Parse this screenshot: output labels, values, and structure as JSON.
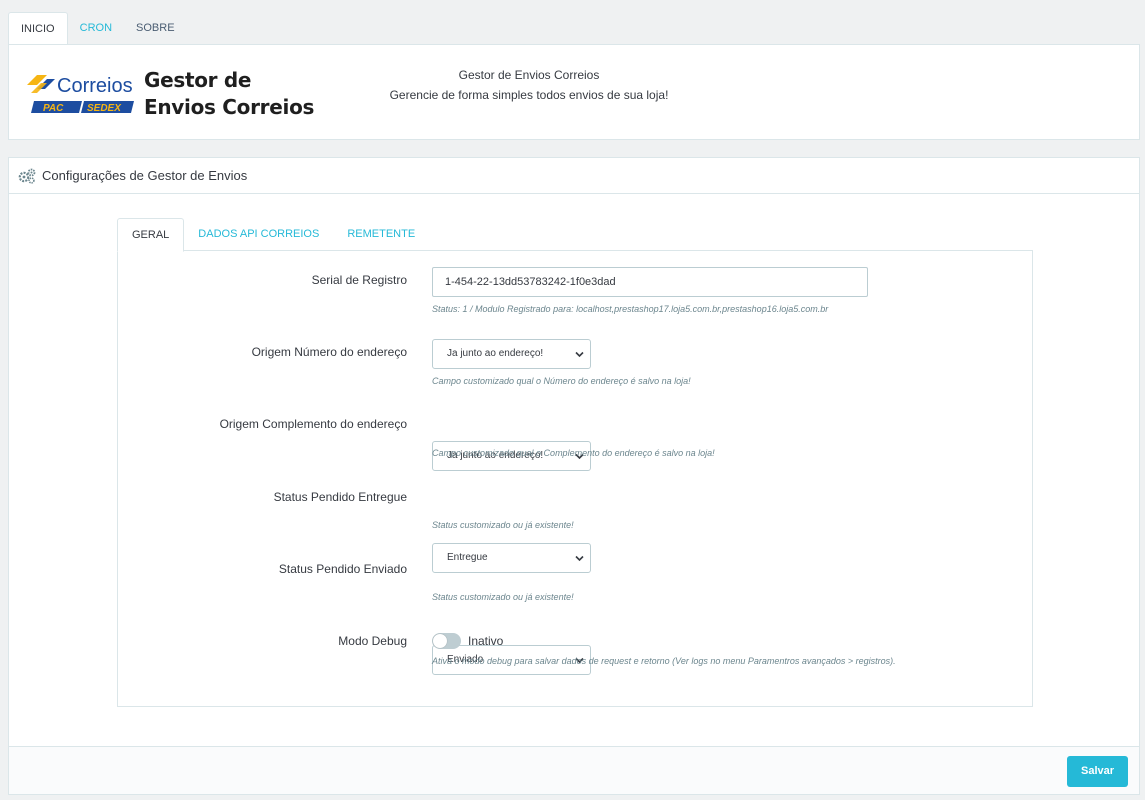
{
  "top_tabs": [
    {
      "label": "INICIO",
      "active": true
    },
    {
      "label": "CRON",
      "active": false
    },
    {
      "label": "SOBRE",
      "active": false
    }
  ],
  "header": {
    "logo_text": "Correios",
    "logo_badge_pac": "PAC",
    "logo_badge_sedex": "SEDEX",
    "title_line1": "Gestor de",
    "title_line2": "Envios Correios",
    "desc_line1": "Gestor de Envios Correios",
    "desc_line2": "Gerencie de forma simples todos envios de sua loja!"
  },
  "config": {
    "title": "Configurações de Gestor de Envios",
    "tabs": [
      {
        "label": "GERAL",
        "active": true
      },
      {
        "label": "DADOS API CORREIOS",
        "active": false
      },
      {
        "label": "REMETENTE",
        "active": false
      }
    ],
    "fields": {
      "serial": {
        "label": "Serial de Registro",
        "value": "1-454-22-13dd53783242-1f0e3dad",
        "help": "Status: 1 / Modulo Registrado para: localhost,prestashop17.loja5.com.br,prestashop16.loja5.com.br"
      },
      "origem_numero": {
        "label": "Origem Número do endereço",
        "value": "Ja junto ao endereço!",
        "help": "Campo customizado qual o Número do endereço é salvo na loja!"
      },
      "origem_complemento": {
        "label": "Origem Complemento do endereço",
        "value": "Ja junto ao endereço!",
        "help": "Campo customizado qual o Complemento do endereço é salvo na loja!"
      },
      "status_entregue": {
        "label": "Status Pendido Entregue",
        "value": "Entregue",
        "help": "Status customizado ou já existente!"
      },
      "status_enviado": {
        "label": "Status Pendido Enviado",
        "value": "Enviado",
        "help": "Status customizado ou já existente!"
      },
      "modo_debug": {
        "label": "Modo Debug",
        "state_label": "Inativo",
        "enabled": false,
        "help": "Ativa o modo debug para salvar dados de request e retorno (Ver logs no menu Paramentros avançados > registros)."
      }
    },
    "save_label": "Salvar"
  },
  "colors": {
    "accent": "#25b9d7",
    "border": "#dbe6e9",
    "text": "#363a41",
    "help_text": "#6c868e"
  }
}
